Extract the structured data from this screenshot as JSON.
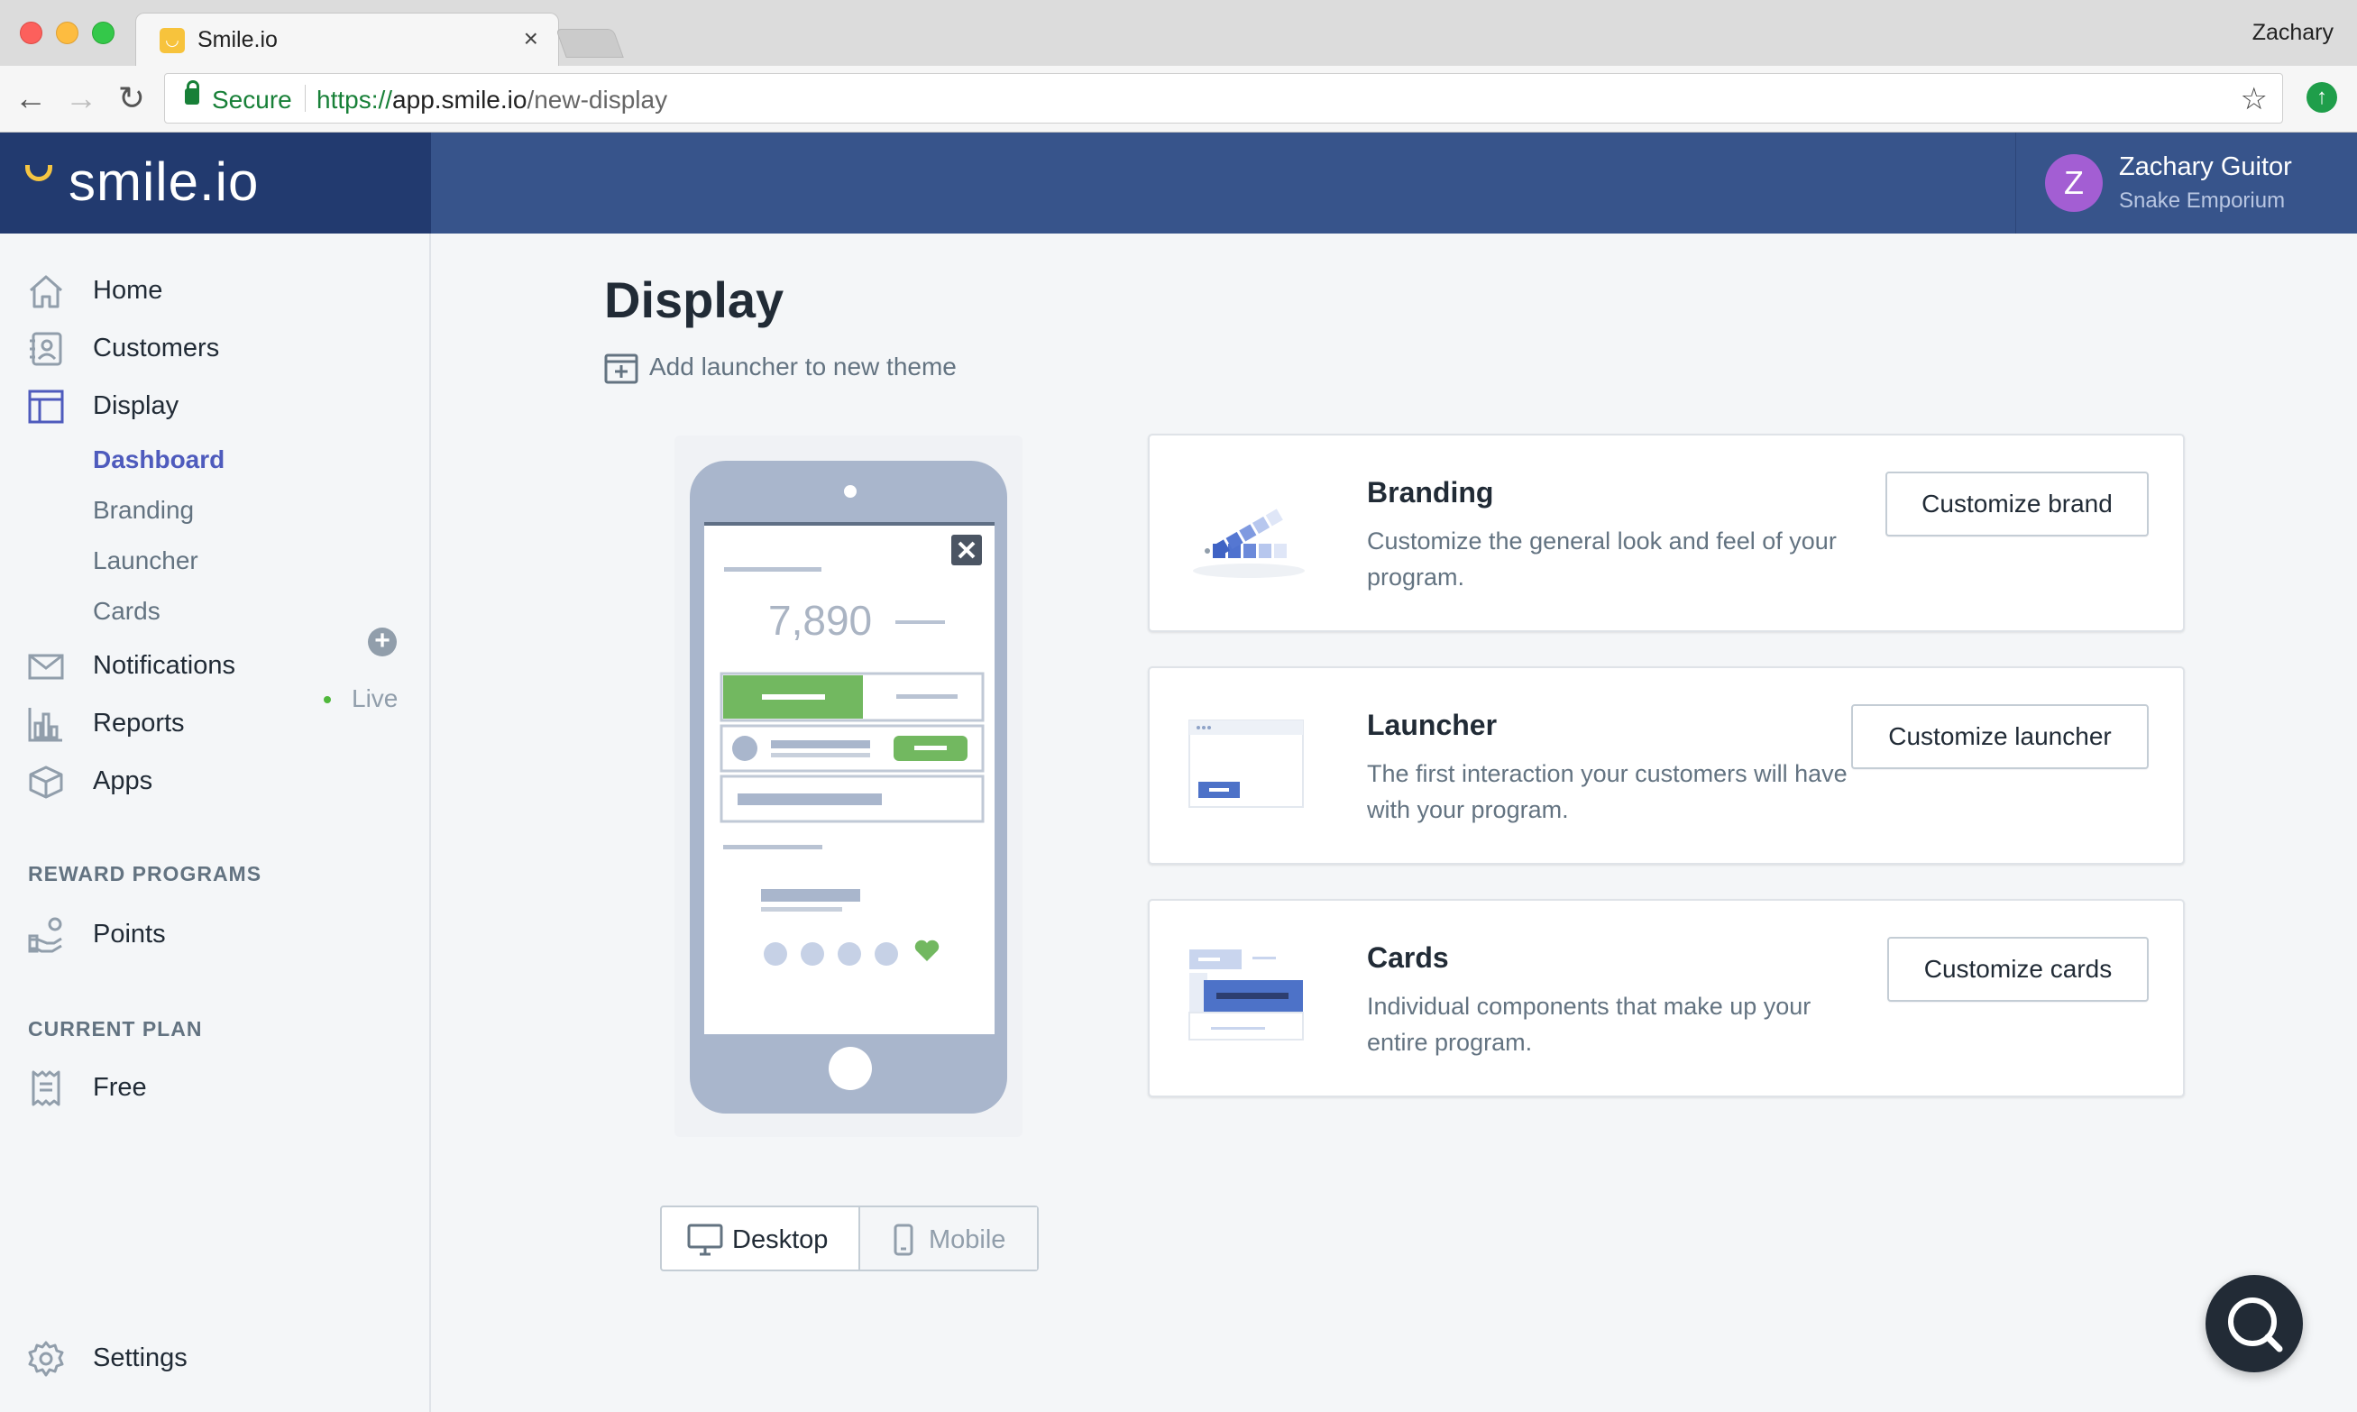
{
  "browser": {
    "tab_title": "Smile.io",
    "profile_name": "Zachary",
    "secure_label": "Secure",
    "url_scheme": "https://",
    "url_host": "app.smile.io",
    "url_path": "/new-display"
  },
  "header": {
    "brand": "smile.io",
    "user": {
      "initial": "Z",
      "name": "Zachary Guitor",
      "shop": "Snake Emporium"
    }
  },
  "sidebar": {
    "nav": {
      "home": "Home",
      "customers": "Customers",
      "display": "Display",
      "notifications": "Notifications",
      "reports": "Reports",
      "apps": "Apps",
      "settings": "Settings"
    },
    "display_sub": {
      "dashboard": "Dashboard",
      "branding": "Branding",
      "launcher": "Launcher",
      "cards": "Cards"
    },
    "reward_programs_label": "REWARD PROGRAMS",
    "points_label": "Points",
    "points_status": "Live",
    "current_plan_label": "CURRENT PLAN",
    "plan_name": "Free"
  },
  "main": {
    "title": "Display",
    "add_launcher": "Add launcher to new theme",
    "preview_points": "7,890",
    "toggle": {
      "desktop": "Desktop",
      "mobile": "Mobile",
      "selected": "Desktop"
    },
    "cards": [
      {
        "title": "Branding",
        "description": "Customize the general look and feel of your program.",
        "button": "Customize brand"
      },
      {
        "title": "Launcher",
        "description": "The first interaction your customers will have with your program.",
        "button": "Customize launcher"
      },
      {
        "title": "Cards",
        "description": "Individual components that make up your entire program.",
        "button": "Customize cards"
      }
    ]
  },
  "colors": {
    "header_bg": "#37548b",
    "brand_bg": "#223a6f",
    "accent": "#4e5bbd",
    "live_green": "#50b83c",
    "avatar": "#a35ed3"
  }
}
